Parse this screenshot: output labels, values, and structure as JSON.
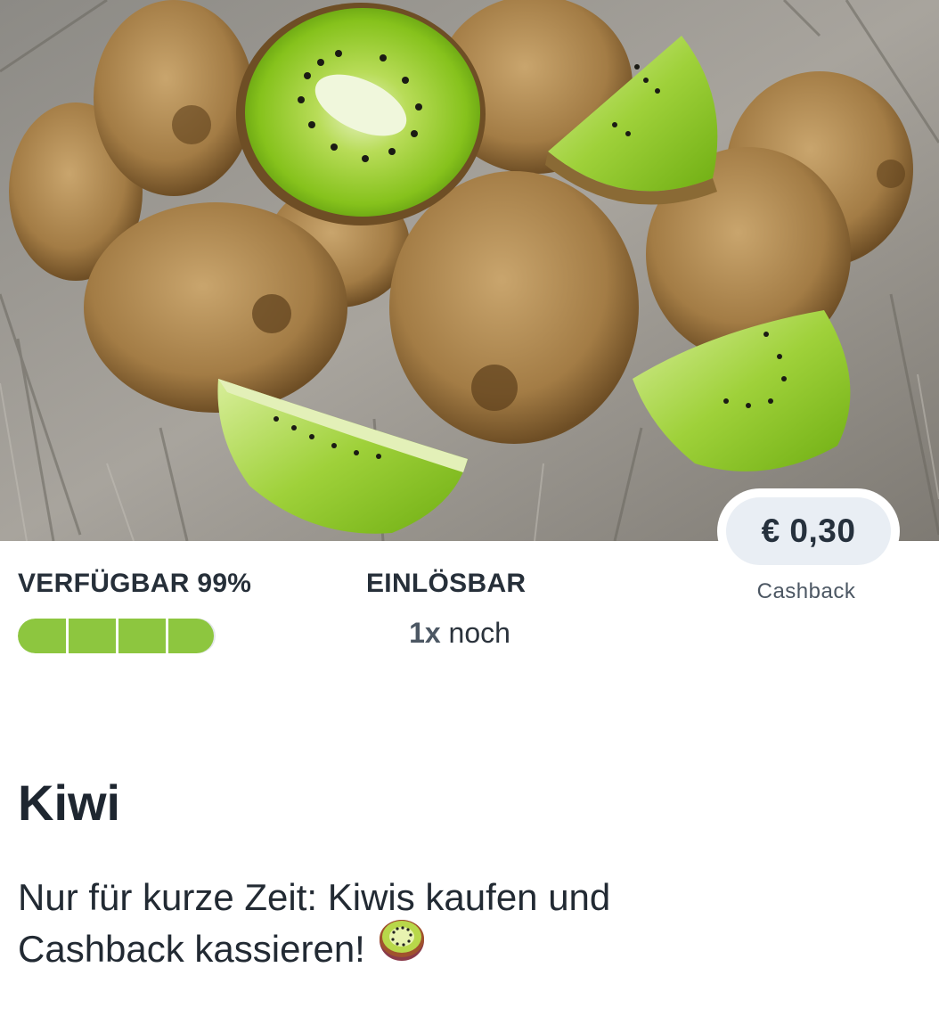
{
  "availability": {
    "label": "VERFÜGBAR 99%",
    "percent": 99,
    "segments": 4
  },
  "redeemable": {
    "label": "EINLÖSBAR",
    "count": "1x",
    "suffix": "noch"
  },
  "cashback": {
    "amount": "€ 0,30",
    "label": "Cashback"
  },
  "product": {
    "title": "Kiwi",
    "description_line1": "Nur für kurze Zeit: Kiwis kaufen und",
    "description_line2": "Cashback kassieren!"
  },
  "colors": {
    "accent_green": "#8dc63f",
    "pill_bg": "#e9eef4",
    "text_dark": "#262f39"
  },
  "icons": {
    "hero": "kiwi-fruit-photo",
    "emoji": "kiwi-emoji-icon"
  }
}
